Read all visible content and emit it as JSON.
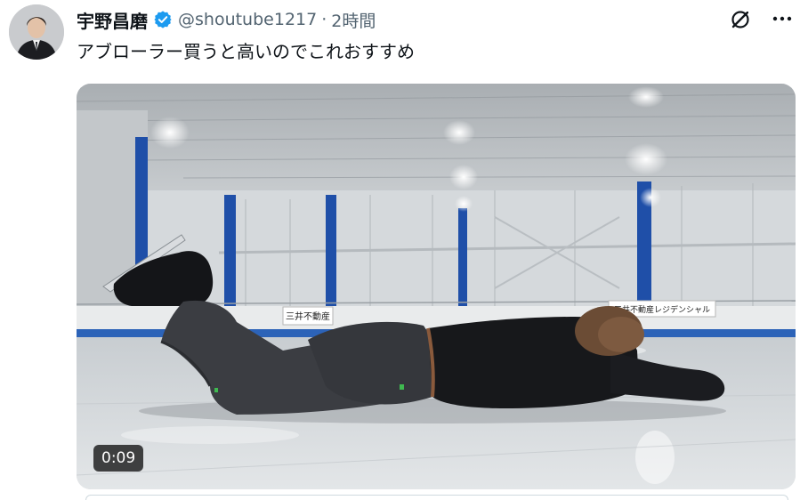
{
  "post": {
    "author": {
      "display_name": "宇野昌磨",
      "handle": "@shoutube1217",
      "verified_icon": "verified-badge-icon",
      "avatar": "profile-avatar"
    },
    "separator": "·",
    "timestamp": "2時間",
    "text": "アブローラー買うと高いのでこれおすすめ",
    "actions": {
      "grok_icon": "grok-icon",
      "more_icon": "more-options-icon"
    },
    "media": {
      "type": "video",
      "duration": "0:09",
      "rink_signs": [
        "三井不動産",
        "三井不動産レジデンシャル"
      ]
    }
  },
  "colors": {
    "text_primary": "#0f1419",
    "text_secondary": "#536471",
    "verified_blue": "#1d9bf0",
    "rink_pillar_blue": "#1f4fa8"
  }
}
